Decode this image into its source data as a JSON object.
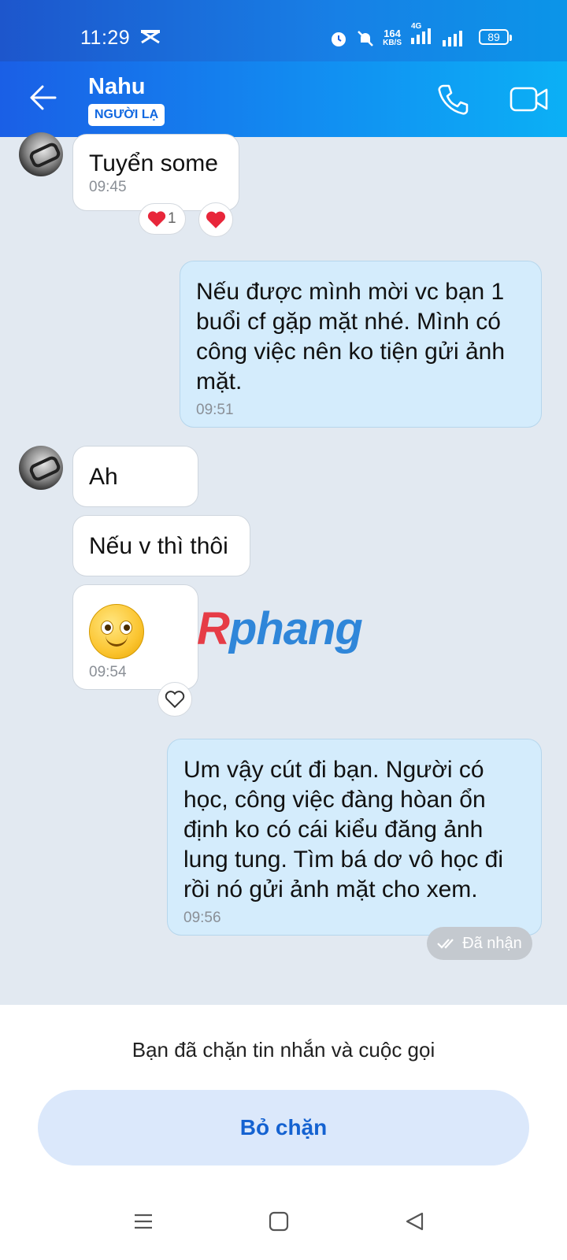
{
  "status_bar": {
    "time": "11:29",
    "speed_value": "164",
    "speed_unit": "KB/S",
    "network": "4G",
    "battery": "89"
  },
  "header": {
    "contact_name": "Nahu",
    "stranger_badge": "NGƯỜI LẠ"
  },
  "messages": [
    {
      "side": "in",
      "text": "Tuyển some",
      "time": "09:45",
      "reaction_count": "1"
    },
    {
      "side": "out",
      "text": "Nếu được mình mời vc bạn 1 buổi cf gặp mặt nhé. Mình có công việc nên ko tiện gửi ảnh mặt.",
      "time": "09:51"
    },
    {
      "side": "in",
      "text": "Ah"
    },
    {
      "side": "in",
      "text": "Nếu v thì thôi"
    },
    {
      "side": "in",
      "text": "",
      "time": "09:54",
      "emoji": "smile"
    },
    {
      "side": "out",
      "text": "Um vậy cút đi bạn. Người có học, công việc đàng hòan ổn định ko có cái kiểu đăng ảnh lung tung. Tìm bá dơ vô học đi rồi nó gửi ảnh mặt cho xem.",
      "time": "09:56"
    }
  ],
  "delivery_status": "Đã nhận",
  "watermark": {
    "first": "R",
    "rest": "phang"
  },
  "footer": {
    "blocked_notice": "Bạn đã chặn tin nhắn và cuộc gọi",
    "unblock_label": "Bỏ chặn"
  },
  "colors": {
    "header_start": "#1a5fe6",
    "header_end": "#0bb0f5",
    "chat_bg": "#e2e9f1",
    "outgoing_bubble": "#d4ecfc",
    "accent": "#1462d1",
    "heart": "#e8263a"
  },
  "icons": [
    "back-arrow-icon",
    "phone-icon",
    "video-call-icon",
    "heart-icon",
    "double-check-icon",
    "menu-icon",
    "home-icon",
    "back-triangle-icon"
  ]
}
